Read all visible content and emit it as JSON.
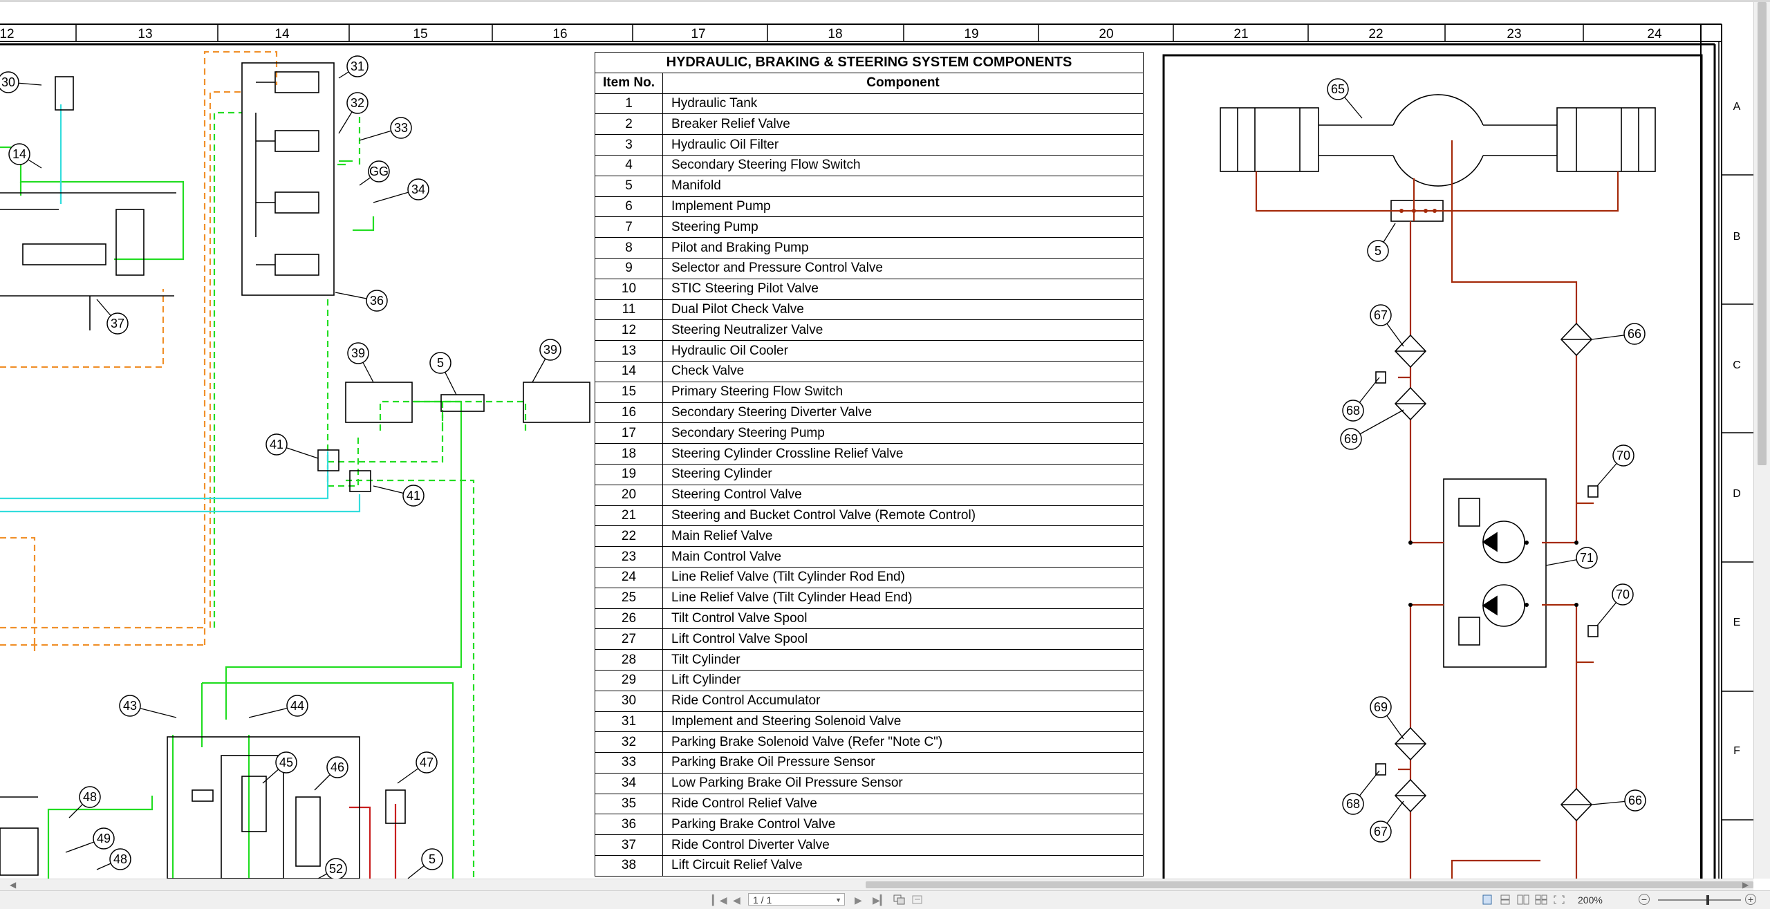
{
  "ruler": {
    "columns": [
      "12",
      "13",
      "14",
      "15",
      "16",
      "17",
      "18",
      "19",
      "20",
      "21",
      "22",
      "23",
      "24"
    ],
    "rows": [
      "A",
      "B",
      "C",
      "D",
      "E",
      "F"
    ]
  },
  "table": {
    "title": "HYDRAULIC, BRAKING & STEERING SYSTEM COMPONENTS",
    "header_item": "Item No.",
    "header_component": "Component",
    "rows": [
      {
        "no": "1",
        "name": "Hydraulic Tank"
      },
      {
        "no": "2",
        "name": "Breaker Relief Valve"
      },
      {
        "no": "3",
        "name": "Hydraulic Oil Filter"
      },
      {
        "no": "4",
        "name": "Secondary Steering Flow Switch"
      },
      {
        "no": "5",
        "name": "Manifold"
      },
      {
        "no": "6",
        "name": "Implement Pump"
      },
      {
        "no": "7",
        "name": "Steering Pump"
      },
      {
        "no": "8",
        "name": "Pilot and Braking Pump"
      },
      {
        "no": "9",
        "name": "Selector and Pressure Control Valve"
      },
      {
        "no": "10",
        "name": "STIC Steering Pilot Valve"
      },
      {
        "no": "11",
        "name": "Dual Pilot Check Valve"
      },
      {
        "no": "12",
        "name": "Steering Neutralizer Valve"
      },
      {
        "no": "13",
        "name": "Hydraulic Oil Cooler"
      },
      {
        "no": "14",
        "name": "Check Valve"
      },
      {
        "no": "15",
        "name": "Primary Steering Flow Switch"
      },
      {
        "no": "16",
        "name": "Secondary Steering Diverter Valve"
      },
      {
        "no": "17",
        "name": "Secondary Steering Pump"
      },
      {
        "no": "18",
        "name": "Steering Cylinder Crossline Relief Valve"
      },
      {
        "no": "19",
        "name": "Steering Cylinder"
      },
      {
        "no": "20",
        "name": "Steering Control Valve"
      },
      {
        "no": "21",
        "name": "Steering and Bucket Control Valve (Remote Control)"
      },
      {
        "no": "22",
        "name": "Main Relief Valve"
      },
      {
        "no": "23",
        "name": "Main Control Valve"
      },
      {
        "no": "24",
        "name": "Line Relief Valve (Tilt Cylinder Rod End)"
      },
      {
        "no": "25",
        "name": "Line Relief Valve (Tilt Cylinder Head End)"
      },
      {
        "no": "26",
        "name": "Tilt Control Valve Spool"
      },
      {
        "no": "27",
        "name": "Lift Control Valve Spool"
      },
      {
        "no": "28",
        "name": "Tilt Cylinder"
      },
      {
        "no": "29",
        "name": "Lift Cylinder"
      },
      {
        "no": "30",
        "name": "Ride Control Accumulator"
      },
      {
        "no": "31",
        "name": "Implement and Steering Solenoid Valve"
      },
      {
        "no": "32",
        "name": "Parking Brake Solenoid Valve (Refer \"Note C\")"
      },
      {
        "no": "33",
        "name": "Parking Brake Oil Pressure Sensor"
      },
      {
        "no": "34",
        "name": "Low Parking Brake Oil Pressure Sensor"
      },
      {
        "no": "35",
        "name": "Ride Control Relief Valve"
      },
      {
        "no": "36",
        "name": "Parking Brake Control Valve"
      },
      {
        "no": "37",
        "name": "Ride Control Diverter Valve"
      },
      {
        "no": "38",
        "name": "Lift Circuit Relief Valve"
      }
    ]
  },
  "callouts": {
    "left": [
      "30",
      "14",
      "37",
      "31",
      "32",
      "33",
      "GG",
      "34",
      "36",
      "39",
      "5",
      "39",
      "41",
      "41",
      "43",
      "44",
      "45",
      "46",
      "47",
      "48",
      "49",
      "48",
      "52",
      "5"
    ],
    "right": [
      "65",
      "5",
      "67",
      "66",
      "68",
      "69",
      "70",
      "71",
      "70",
      "69",
      "68",
      "67",
      "66"
    ]
  },
  "line_colors": {
    "green": "#22dd22",
    "cyan": "#33dddd",
    "orange": "#f0902a",
    "brown": "#a52a0a",
    "black": "#000000"
  },
  "statusbar": {
    "page": "1 / 1",
    "zoom": "200%"
  },
  "icons": {
    "first_page": "first-page-icon",
    "prev_page": "prev-page-icon",
    "next_page": "next-page-icon",
    "last_page": "last-page-icon",
    "zoom_out": "zoom-out-icon",
    "zoom_in": "zoom-in-icon"
  }
}
